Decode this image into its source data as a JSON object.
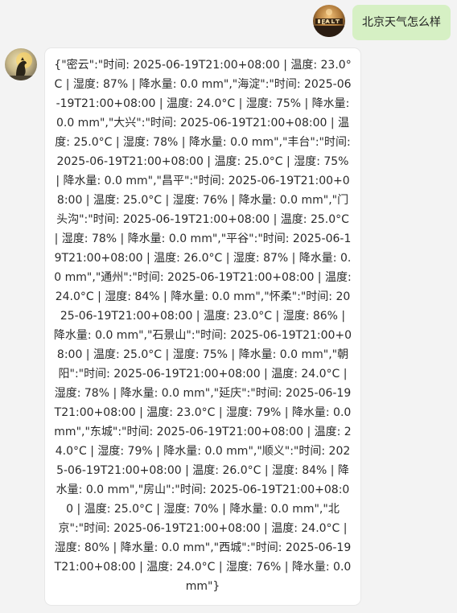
{
  "user_message": {
    "text": "北京天气怎么样"
  },
  "assistant_message": {
    "text": "{\"密云\":\"时间: 2025-06-19T21:00+08:00 | 温度: 23.0°C | 湿度: 87% | 降水量: 0.0 mm\",\"海淀\":\"时间: 2025-06-19T21:00+08:00 | 温度: 24.0°C | 湿度: 75% | 降水量: 0.0 mm\",\"大兴\":\"时间: 2025-06-19T21:00+08:00 | 温度: 25.0°C | 湿度: 78% | 降水量: 0.0 mm\",\"丰台\":\"时间: 2025-06-19T21:00+08:00 | 温度: 25.0°C | 湿度: 75% | 降水量: 0.0 mm\",\"昌平\":\"时间: 2025-06-19T21:00+08:00 | 温度: 25.0°C | 湿度: 76% | 降水量: 0.0 mm\",\"门头沟\":\"时间: 2025-06-19T21:00+08:00 | 温度: 25.0°C | 湿度: 78% | 降水量: 0.0 mm\",\"平谷\":\"时间: 2025-06-19T21:00+08:00 | 温度: 26.0°C | 湿度: 87% | 降水量: 0.0 mm\",\"通州\":\"时间: 2025-06-19T21:00+08:00 | 温度: 24.0°C | 湿度: 84% | 降水量: 0.0 mm\",\"怀柔\":\"时间: 2025-06-19T21:00+08:00 | 温度: 23.0°C | 湿度: 86% | 降水量: 0.0 mm\",\"石景山\":\"时间: 2025-06-19T21:00+08:00 | 温度: 25.0°C | 湿度: 75% | 降水量: 0.0 mm\",\"朝阳\":\"时间: 2025-06-19T21:00+08:00 | 温度: 24.0°C | 湿度: 78% | 降水量: 0.0 mm\",\"延庆\":\"时间: 2025-06-19T21:00+08:00 | 温度: 23.0°C | 湿度: 79% | 降水量: 0.0 mm\",\"东城\":\"时间: 2025-06-19T21:00+08:00 | 温度: 24.0°C | 湿度: 79% | 降水量: 0.0 mm\",\"顺义\":\"时间: 2025-06-19T21:00+08:00 | 温度: 26.0°C | 湿度: 84% | 降水量: 0.0 mm\",\"房山\":\"时间: 2025-06-19T21:00+08:00 | 温度: 25.0°C | 湿度: 70% | 降水量: 0.0 mm\",\"北京\":\"时间: 2025-06-19T21:00+08:00 | 温度: 24.0°C | 湿度: 80% | 降水量: 0.0 mm\",\"西城\":\"时间: 2025-06-19T21:00+08:00 | 温度: 24.0°C | 湿度: 76% | 降水量: 0.0 mm\"}"
  },
  "colors": {
    "background": "#f3f3f3",
    "user_bubble": "#d6f0c4",
    "assistant_bubble": "#ffffff"
  },
  "icons": {
    "user_avatar": "user-avatar-icon",
    "assistant_avatar": "assistant-avatar-icon"
  }
}
